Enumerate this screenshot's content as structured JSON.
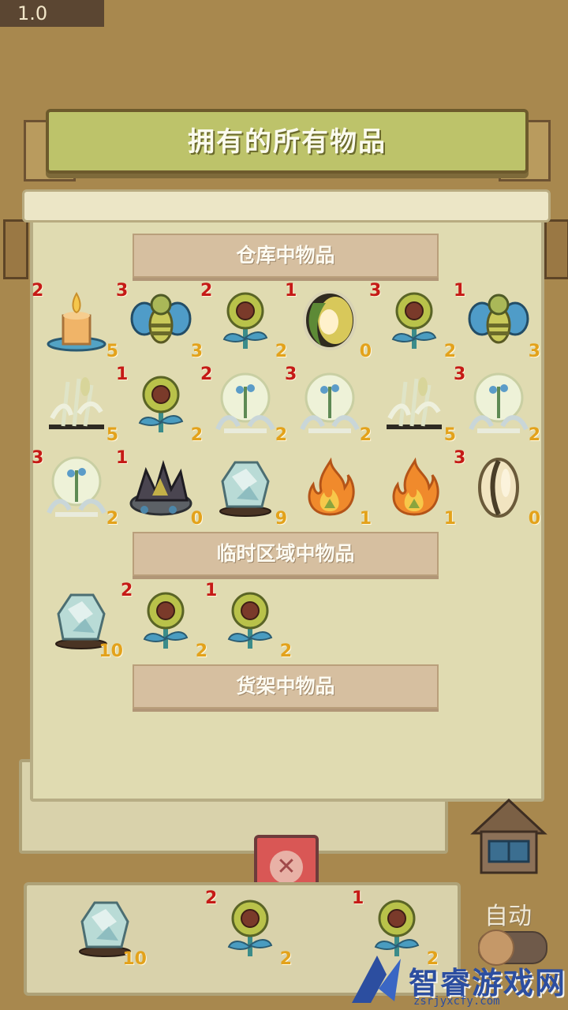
{
  "version": "1.0",
  "banner_title": "拥有的所有物品",
  "sections": {
    "warehouse": "仓库中物品",
    "temp": "临时区域中物品",
    "shelf": "货架中物品"
  },
  "warehouse_items": [
    {
      "icon": "candle-icon",
      "level": "2",
      "count": "5"
    },
    {
      "icon": "bee-icon",
      "level": "3",
      "count": "3"
    },
    {
      "icon": "sunflower-icon",
      "level": "2",
      "count": "2"
    },
    {
      "icon": "seed-pod-icon",
      "level": "1",
      "count": "0"
    },
    {
      "icon": "sunflower-icon",
      "level": "3",
      "count": "2"
    },
    {
      "icon": "bee-icon",
      "level": "1",
      "count": "3"
    },
    {
      "icon": "wheat-icon",
      "level": "",
      "count": "5"
    },
    {
      "icon": "sunflower-icon",
      "level": "1",
      "count": "2"
    },
    {
      "icon": "glass-sprout-icon",
      "level": "2",
      "count": "2"
    },
    {
      "icon": "glass-sprout-icon",
      "level": "3",
      "count": "2"
    },
    {
      "icon": "wheat-icon",
      "level": "",
      "count": "5"
    },
    {
      "icon": "glass-sprout-icon",
      "level": "3",
      "count": "2"
    },
    {
      "icon": "glass-sprout-icon",
      "level": "3",
      "count": "2"
    },
    {
      "icon": "coal-pile-icon",
      "level": "1",
      "count": "0"
    },
    {
      "icon": "crystal-icon",
      "level": "",
      "count": "9"
    },
    {
      "icon": "fire-icon",
      "level": "",
      "count": "1"
    },
    {
      "icon": "fire-icon",
      "level": "",
      "count": "1"
    },
    {
      "icon": "seed-icon",
      "level": "3",
      "count": "0"
    }
  ],
  "temp_items": [
    {
      "icon": "crystal-icon",
      "level": "",
      "count": "10"
    },
    {
      "icon": "sunflower-icon",
      "level": "2",
      "count": "2"
    },
    {
      "icon": "sunflower-icon",
      "level": "1",
      "count": "2"
    }
  ],
  "tray_items": [
    {
      "icon": "crystal-icon",
      "level": "",
      "count": "10"
    },
    {
      "icon": "sunflower-icon",
      "level": "2",
      "count": "2"
    },
    {
      "icon": "sunflower-icon",
      "level": "1",
      "count": "2"
    }
  ],
  "close_glyph": "✕",
  "auto_label": "自动",
  "watermark": {
    "text": "智睿游戏网",
    "sub": "zsrjyxcfy.com"
  }
}
